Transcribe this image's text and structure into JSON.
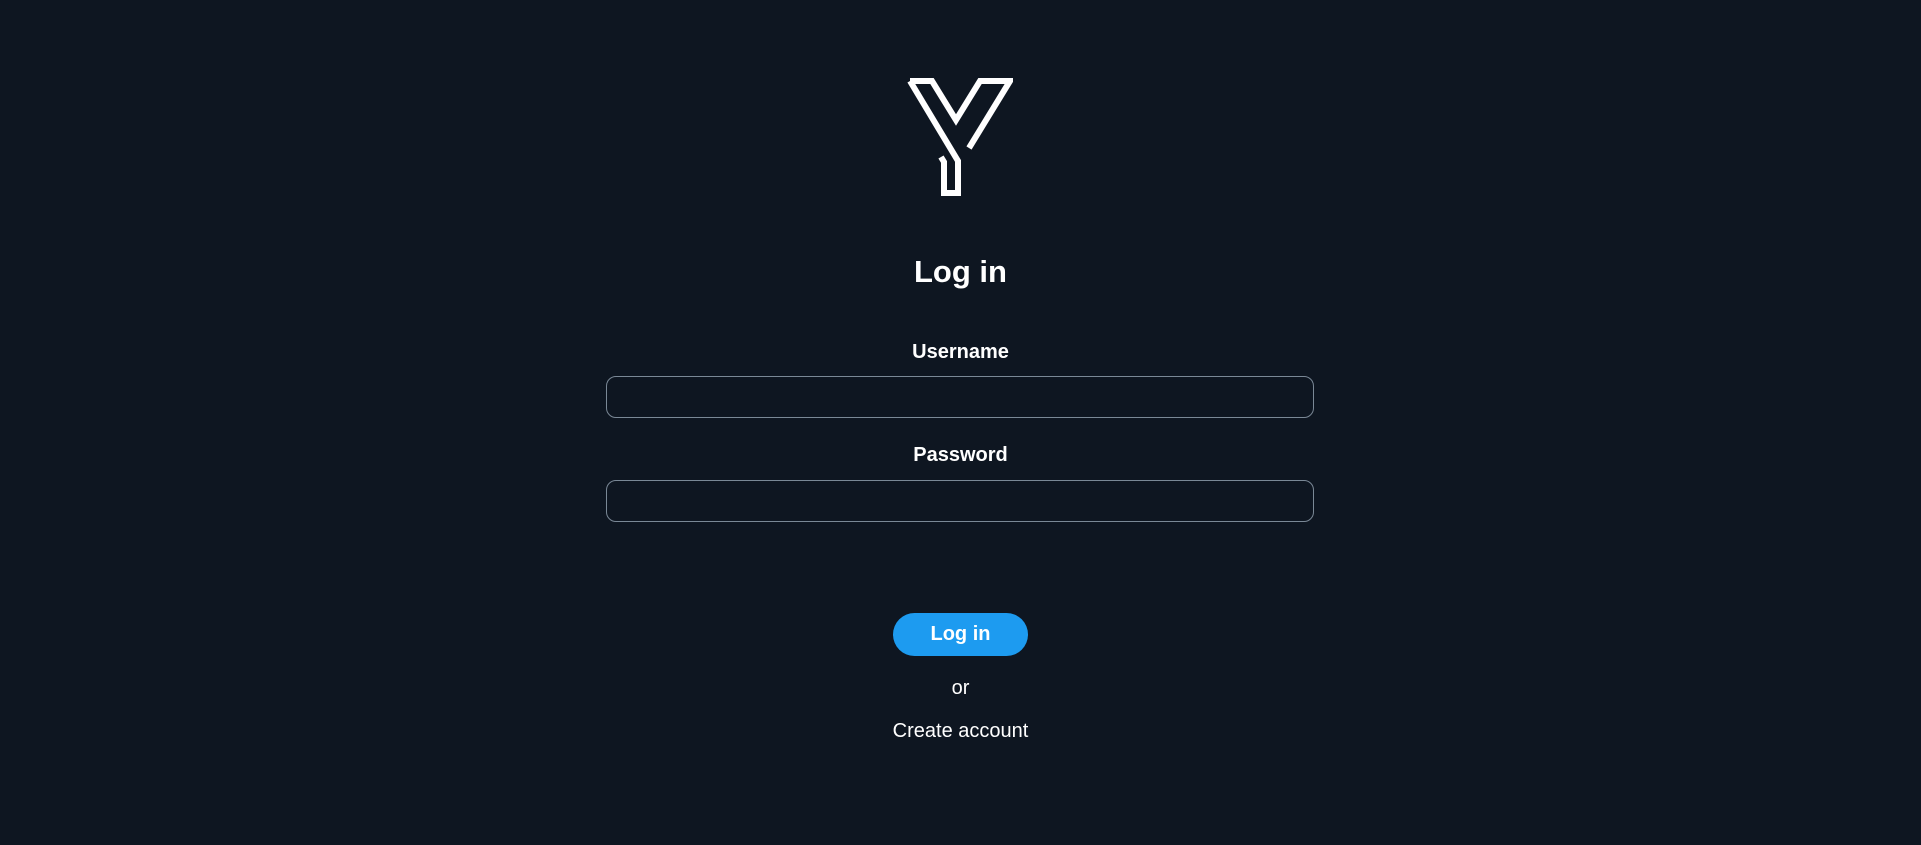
{
  "login": {
    "title": "Log in",
    "username_label": "Username",
    "username_value": "",
    "password_label": "Password",
    "password_value": "",
    "submit_label": "Log in",
    "separator_text": "or",
    "create_account_label": "Create account"
  },
  "logo": {
    "icon": "y-logo-icon",
    "color": "#ffffff"
  },
  "colors": {
    "background": "#0e1621",
    "accent": "#1d9bf0",
    "input_border": "#7a8896",
    "text": "#ffffff"
  }
}
